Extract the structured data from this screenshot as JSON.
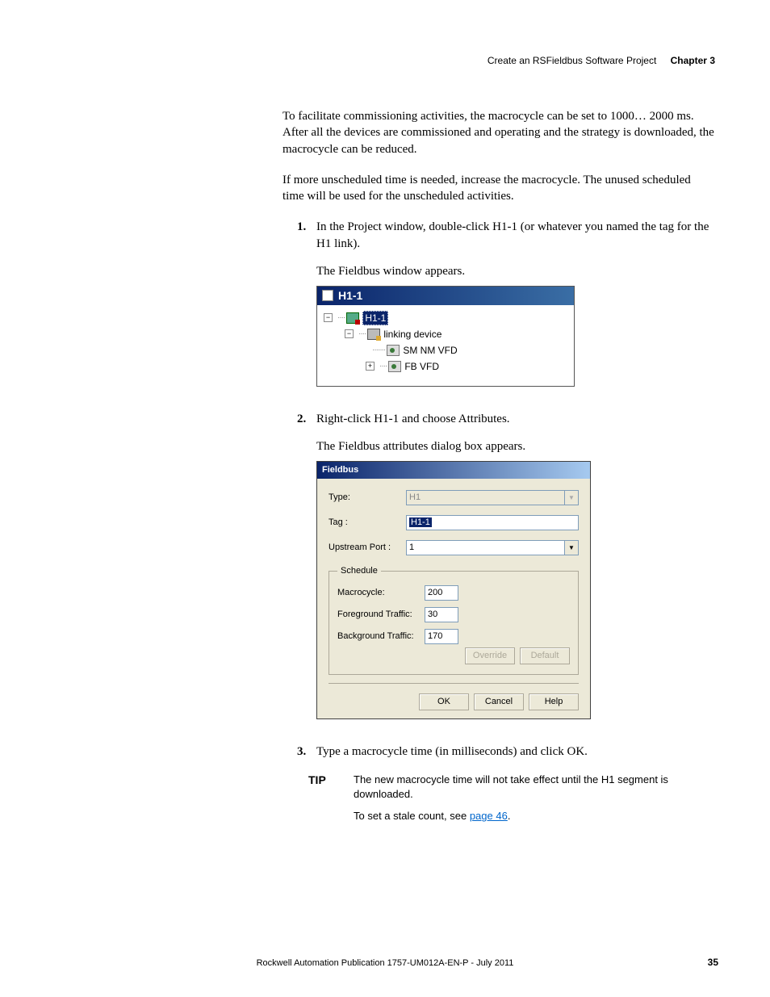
{
  "header": {
    "section_title": "Create an RSFieldbus Software Project",
    "chapter": "Chapter 3"
  },
  "paragraphs": {
    "p1": "To facilitate commissioning activities, the macrocycle can be set to 1000… 2000 ms. After all the devices are commissioned and operating and the strategy is downloaded, the macrocycle can be reduced.",
    "p2": "If more unscheduled time is needed, increase the macrocycle. The unused scheduled time will be used for the unscheduled activities."
  },
  "steps": {
    "s1": {
      "num": "1.",
      "text": "In the Project window, double-click H1-1 (or whatever you named the tag for the H1 link).",
      "sub": "The Fieldbus window appears."
    },
    "s2": {
      "num": "2.",
      "text": "Right-click H1-1 and choose Attributes.",
      "sub": "The Fieldbus attributes dialog box appears."
    },
    "s3": {
      "num": "3.",
      "text": "Type a macrocycle time (in milliseconds) and click OK."
    }
  },
  "window1": {
    "title": "H1-1",
    "tree": {
      "root": "H1-1",
      "child1": "linking device",
      "leaf1": "SM NM VFD",
      "leaf2": "FB VFD"
    }
  },
  "dialog": {
    "title": "Fieldbus",
    "type_label": "Type:",
    "type_value": "H1",
    "tag_label": "Tag :",
    "tag_value": "H1-1",
    "port_label": "Upstream Port :",
    "port_value": "1",
    "schedule_legend": "Schedule",
    "macro_label": "Macrocycle:",
    "macro_value": "200",
    "fg_label": "Foreground Traffic:",
    "fg_value": "30",
    "bg_label": "Background Traffic:",
    "bg_value": "170",
    "override_btn": "Override",
    "default_btn": "Default",
    "ok_btn": "OK",
    "cancel_btn": "Cancel",
    "help_btn": "Help"
  },
  "tip": {
    "label": "TIP",
    "line1": "The new macrocycle time will not take effect until the H1 segment is downloaded.",
    "line2_pre": "To set a stale count, see ",
    "line2_link": "page 46",
    "line2_post": "."
  },
  "footer": {
    "text": "Rockwell Automation Publication 1757-UM012A-EN-P - July 2011",
    "page_num": "35"
  }
}
